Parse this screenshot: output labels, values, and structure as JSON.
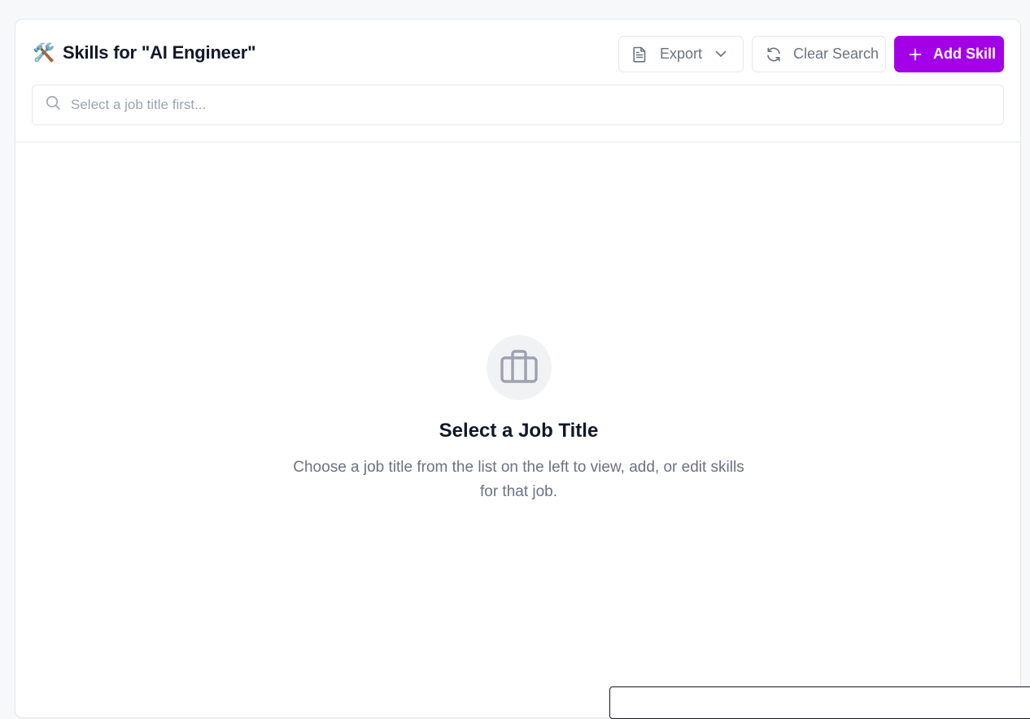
{
  "header": {
    "emoji": "🛠️",
    "title": "Skills for \"AI Engineer\"",
    "export_label": "Export",
    "clear_label": "Clear Search",
    "add_label": "Add Skill"
  },
  "search": {
    "placeholder": "Select a job title first...",
    "value": ""
  },
  "empty_state": {
    "icon": "briefcase-icon",
    "title": "Select a Job Title",
    "description": "Choose a job title from the list on the left to view, add, or edit skills for that job."
  },
  "colors": {
    "accent": "#a300e8",
    "muted_text": "#6b7280",
    "border": "#e5e7eb",
    "icon_gray": "#9ca3af"
  }
}
